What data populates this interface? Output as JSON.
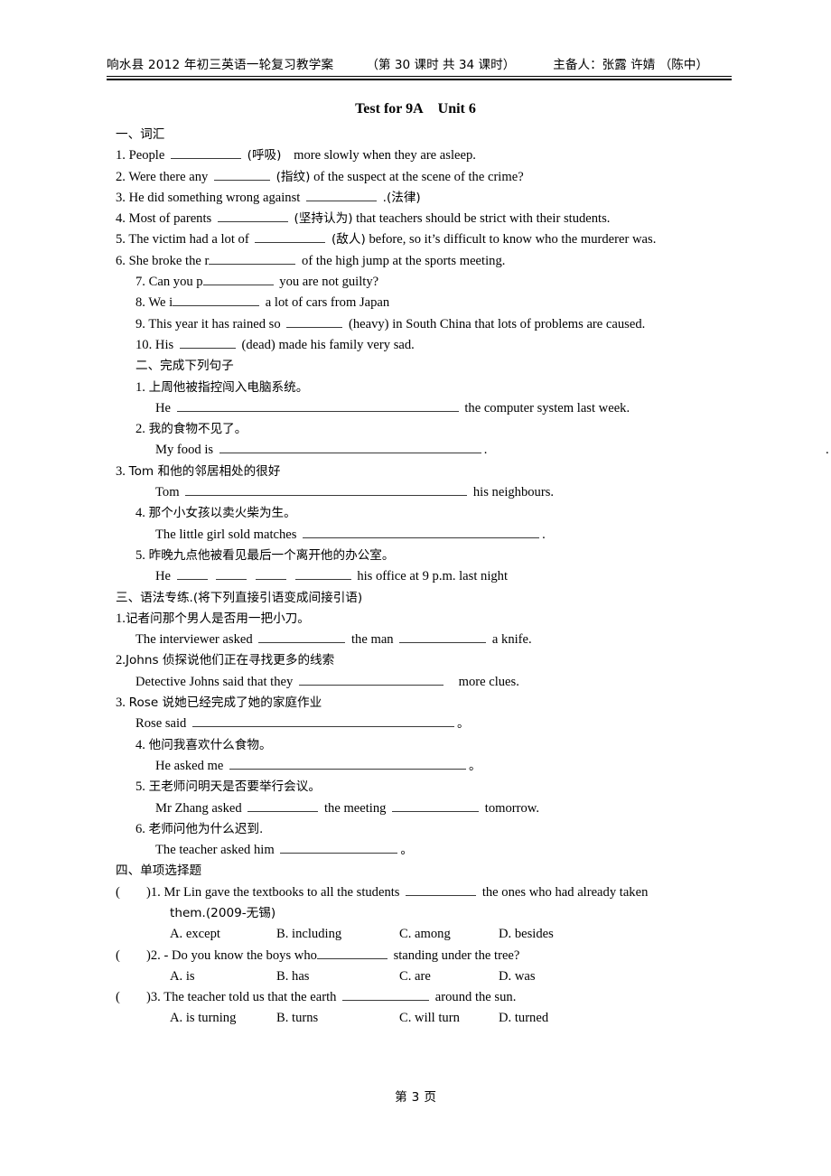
{
  "header": {
    "left": "响水县 2012 年初三英语一轮复习教学案",
    "middle": "（第 30 课时  共 34 课时）",
    "right": "主备人：张露  许婧 （陈中）"
  },
  "title": {
    "part1": "Test for 9A",
    "part2": "Unit 6"
  },
  "section1": {
    "heading": "一、词汇",
    "items": [
      {
        "num": "1.",
        "pre": "People",
        "hint": "(呼吸)",
        "post": "more slowly when they are asleep."
      },
      {
        "num": "2.",
        "pre": "Were there any",
        "hint": "(指纹)",
        "post": "of the suspect at the scene of the crime?"
      },
      {
        "num": "3.",
        "pre": "He did something wrong against",
        "hint": ".(法律)",
        "post": ""
      },
      {
        "num": "4.",
        "pre": "Most of parents",
        "hint": "(坚持认为)",
        "post": "that teachers should be strict with their students."
      },
      {
        "num": "5.",
        "pre": "The victim had a lot of",
        "hint": "(敌人)",
        "post": "before, so it’s difficult to know who the murderer was."
      },
      {
        "num": "6.",
        "pre": "She broke the r",
        "hint": "",
        "post": "of the high jump at the sports meeting."
      },
      {
        "num": "7.",
        "pre": "Can you p",
        "hint": "",
        "post": "you are not guilty?"
      },
      {
        "num": "8.",
        "pre": "We i",
        "hint": "",
        "post": "a lot of cars from Japan"
      },
      {
        "num": "9.",
        "pre": "This year it has rained so",
        "hint": "(heavy)",
        "post": "in South China that lots of problems are caused."
      },
      {
        "num": "10.",
        "pre": "His",
        "hint": "(dead)",
        "post": "made his family very sad."
      }
    ]
  },
  "section2": {
    "heading": "二、完成下列句子",
    "items": [
      {
        "num": "1.",
        "cn": "上周他被指控闯入电脑系统。",
        "pre": "He",
        "post": "the computer system last week."
      },
      {
        "num": "2.",
        "cn": "我的食物不见了。",
        "pre": "My food is",
        "post": ".",
        "stray": "."
      },
      {
        "num": "3.",
        "cn": "Tom 和他的邻居相处的很好",
        "pre": "Tom",
        "post": "his neighbours."
      },
      {
        "num": "4.",
        "cn": "那个小女孩以卖火柴为生。",
        "pre": "The little girl sold matches",
        "post": "."
      },
      {
        "num": "5.",
        "cn": "昨晚九点他被看见最后一个离开他的办公室。",
        "pre": "He",
        "post": "his office at 9 p.m. last night"
      }
    ]
  },
  "section3": {
    "heading": "三、语法专练.(将下列直接引语变成间接引语)",
    "items": [
      {
        "num": "1.",
        "cn": "记者问那个男人是否用一把小刀。",
        "pre": "The interviewer asked",
        "mid": "the man",
        "post": "a knife."
      },
      {
        "num": "2.",
        "cn": "Johns  侦探说他们正在寻找更多的线索",
        "pre": "Detective Johns said that they",
        "post": "more clues."
      },
      {
        "num": "3.",
        "cn": "Rose  说她已经完成了她的家庭作业",
        "pre": "Rose said",
        "post": "。"
      },
      {
        "num": "4.",
        "cn": "他问我喜欢什么食物。",
        "pre": "He asked me",
        "post": "。"
      },
      {
        "num": "5.",
        "cn": "王老师问明天是否要举行会议。",
        "pre": "Mr Zhang asked",
        "mid": "the meeting",
        "post": "tomorrow."
      },
      {
        "num": "6.",
        "cn": "老师问他为什么迟到.",
        "pre": "The teacher asked him",
        "post": "。"
      }
    ]
  },
  "section4": {
    "heading": "四、单项选择题",
    "questions": [
      {
        "num": ")1.",
        "stem_pre": "Mr Lin gave the textbooks to all the students",
        "stem_post": "the ones who had already taken",
        "stem_line2": "them.(2009-无锡)",
        "options": [
          "A. except",
          "B. including",
          "C. among",
          "D. besides"
        ]
      },
      {
        "num": ")2.",
        "stem_pre": "- Do you know the boys who",
        "stem_post": "standing under the tree?",
        "stem_line2": "",
        "options": [
          "A. is",
          "B. has",
          "C. are",
          "D. was"
        ]
      },
      {
        "num": ")3.",
        "stem_pre": "The teacher told us that the earth",
        "stem_post": "around the sun.",
        "stem_line2": "",
        "options": [
          "A. is turning",
          "B. turns",
          "C. will turn",
          "D. turned"
        ]
      }
    ]
  },
  "footer": {
    "prefix": "第",
    "page": "3",
    "suffix": "页"
  }
}
